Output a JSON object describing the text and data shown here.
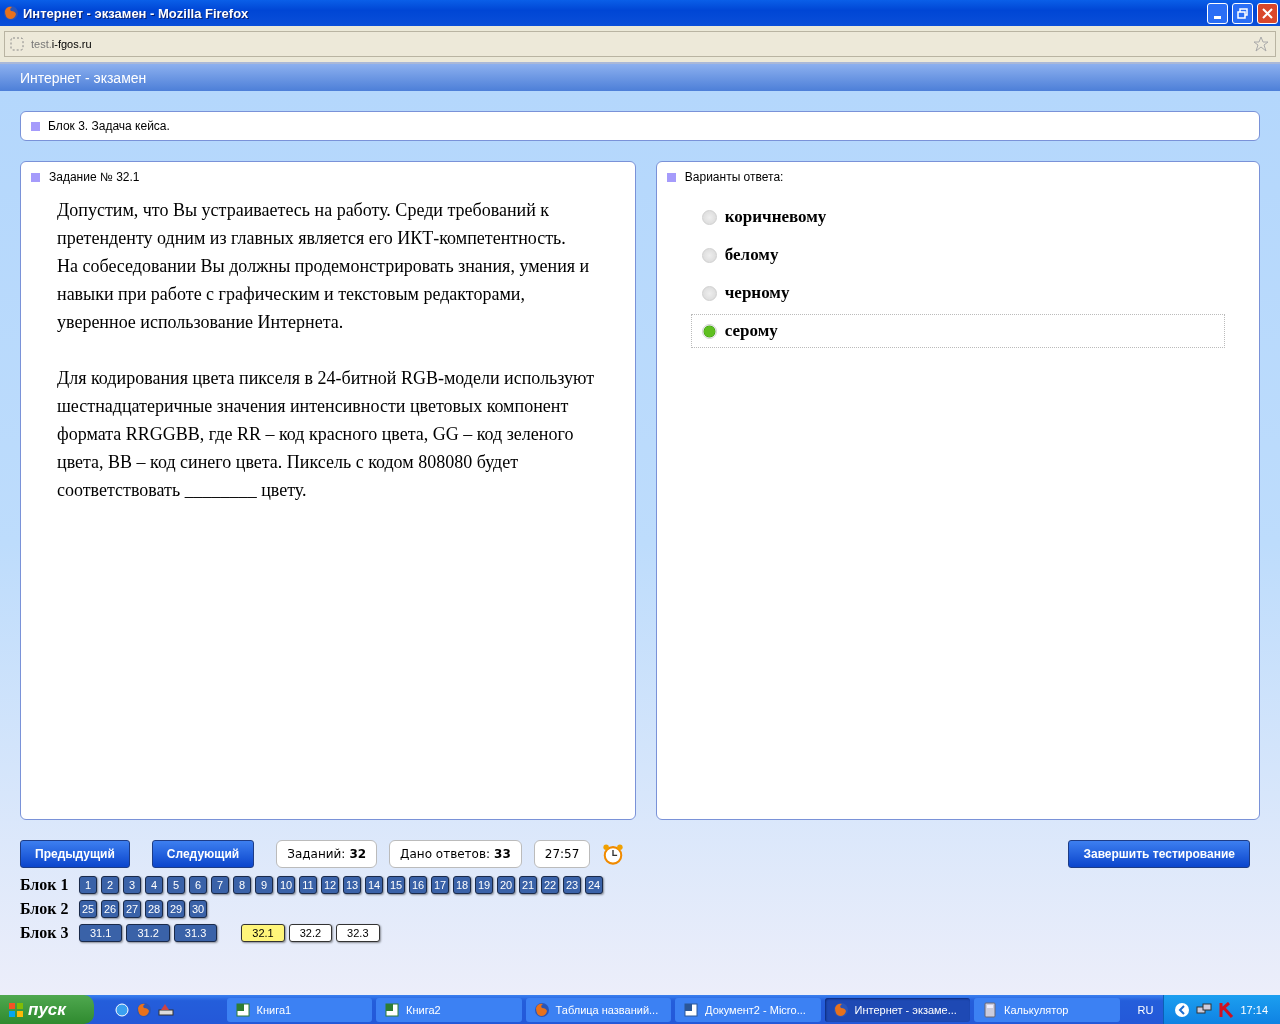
{
  "window": {
    "title": "Интернет - экзамен - Mozilla Firefox"
  },
  "address_bar": {
    "host_prefix": "test.",
    "host": "i-fgos.ru"
  },
  "page_header": {
    "title": "Интернет - экзамен"
  },
  "block_caption": "Блок 3. Задача кейса.",
  "task": {
    "caption": "Задание № 32.1",
    "paragraphs": [
      [
        "Допустим, что Вы устраиваетесь на работу. Среди требований к претенденту одним из главных является его ИКТ-компетентность.",
        "На собеседовании Вы должны продемонстрировать знания, умения и навыки при работе с графическим и текстовым редакторами, уверенное использование Интернета."
      ],
      [
        "Для кодирования цвета пикселя в 24-битной RGB-модели используют шестнадцатеричные значения интенсивности цветовых компонент формата RRGGBB, где RR – код красного цвета, GG – код зеленого цвета, BB – код синего цвета. Пиксель с кодом 808080 будет соответствовать ________ цвету."
      ]
    ]
  },
  "answers": {
    "caption": "Варианты ответа:",
    "options": [
      {
        "label": "коричневому",
        "selected": false
      },
      {
        "label": "белому",
        "selected": false
      },
      {
        "label": "черному",
        "selected": false
      },
      {
        "label": "серому",
        "selected": true
      }
    ]
  },
  "controls": {
    "prev": "Предыдущий",
    "next": "Следующий",
    "tasks_label": "Заданий:",
    "tasks_count": "32",
    "answers_label": "Дано ответов:",
    "answers_count": "33",
    "timer": "27:57",
    "finish": "Завершить тестирование"
  },
  "blocks": [
    {
      "label": "Блок 1",
      "groups": [
        [
          {
            "n": "1",
            "answered": true,
            "selected": false
          },
          {
            "n": "2",
            "answered": true,
            "selected": false
          },
          {
            "n": "3",
            "answered": true,
            "selected": false
          },
          {
            "n": "4",
            "answered": true,
            "selected": false
          },
          {
            "n": "5",
            "answered": true,
            "selected": false
          },
          {
            "n": "6",
            "answered": true,
            "selected": false
          },
          {
            "n": "7",
            "answered": true,
            "selected": false
          },
          {
            "n": "8",
            "answered": true,
            "selected": false
          },
          {
            "n": "9",
            "answered": true,
            "selected": false
          },
          {
            "n": "10",
            "answered": true,
            "selected": false
          },
          {
            "n": "11",
            "answered": true,
            "selected": false
          },
          {
            "n": "12",
            "answered": true,
            "selected": false
          },
          {
            "n": "13",
            "answered": true,
            "selected": false
          },
          {
            "n": "14",
            "answered": true,
            "selected": false
          },
          {
            "n": "15",
            "answered": true,
            "selected": false
          },
          {
            "n": "16",
            "answered": true,
            "selected": false
          },
          {
            "n": "17",
            "answered": true,
            "selected": false
          },
          {
            "n": "18",
            "answered": true,
            "selected": false
          },
          {
            "n": "19",
            "answered": true,
            "selected": false
          },
          {
            "n": "20",
            "answered": true,
            "selected": false
          },
          {
            "n": "21",
            "answered": true,
            "selected": false
          },
          {
            "n": "22",
            "answered": true,
            "selected": false
          },
          {
            "n": "23",
            "answered": true,
            "selected": false
          },
          {
            "n": "24",
            "answered": true,
            "selected": false
          }
        ]
      ]
    },
    {
      "label": "Блок 2",
      "groups": [
        [
          {
            "n": "25",
            "answered": true,
            "selected": false
          },
          {
            "n": "26",
            "answered": true,
            "selected": false
          },
          {
            "n": "27",
            "answered": true,
            "selected": false
          },
          {
            "n": "28",
            "answered": true,
            "selected": false
          },
          {
            "n": "29",
            "answered": true,
            "selected": false
          },
          {
            "n": "30",
            "answered": true,
            "selected": false
          }
        ]
      ]
    },
    {
      "label": "Блок 3",
      "groups": [
        [
          {
            "n": "31.1",
            "answered": true,
            "selected": false
          },
          {
            "n": "31.2",
            "answered": true,
            "selected": false
          },
          {
            "n": "31.3",
            "answered": true,
            "selected": false
          }
        ],
        [
          {
            "n": "32.1",
            "answered": false,
            "selected": true
          },
          {
            "n": "32.2",
            "answered": false,
            "selected": false
          },
          {
            "n": "32.3",
            "answered": false,
            "selected": false
          }
        ]
      ]
    }
  ],
  "taskbar": {
    "start": "пуск",
    "items": [
      {
        "label": "Книга1",
        "kind": "excel",
        "selected": false
      },
      {
        "label": "Книга2",
        "kind": "excel",
        "selected": false
      },
      {
        "label": "Таблица названий...",
        "kind": "firefox",
        "selected": false
      },
      {
        "label": "Документ2 - Micro...",
        "kind": "word",
        "selected": false
      },
      {
        "label": "Интернет - экзаме...",
        "kind": "firefox",
        "selected": true
      },
      {
        "label": "Калькулятор",
        "kind": "calc",
        "selected": false
      }
    ],
    "language": "RU",
    "clock": "17:14"
  }
}
